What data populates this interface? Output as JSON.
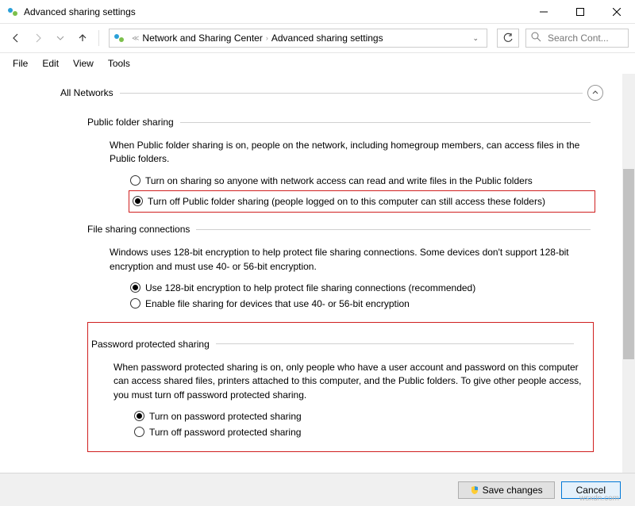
{
  "window": {
    "title": "Advanced sharing settings"
  },
  "nav": {
    "breadcrumb": {
      "parent": "Network and Sharing Center",
      "current": "Advanced sharing settings"
    },
    "search_placeholder": "Search Cont..."
  },
  "menu": {
    "file": "File",
    "edit": "Edit",
    "view": "View",
    "tools": "Tools"
  },
  "section": {
    "all_networks": "All Networks"
  },
  "public_folder": {
    "title": "Public folder sharing",
    "desc": "When Public folder sharing is on, people on the network, including homegroup members, can access files in the Public folders.",
    "opt_on": "Turn on sharing so anyone with network access can read and write files in the Public folders",
    "opt_off": "Turn off Public folder sharing (people logged on to this computer can still access these folders)"
  },
  "file_sharing": {
    "title": "File sharing connections",
    "desc": "Windows uses 128-bit encryption to help protect file sharing connections. Some devices don't support 128-bit encryption and must use 40- or 56-bit encryption.",
    "opt_128": "Use 128-bit encryption to help protect file sharing connections (recommended)",
    "opt_4056": "Enable file sharing for devices that use 40- or 56-bit encryption"
  },
  "password": {
    "title": "Password protected sharing",
    "desc": "When password protected sharing is on, only people who have a user account and password on this computer can access shared files, printers attached to this computer, and the Public folders. To give other people access, you must turn off password protected sharing.",
    "opt_on": "Turn on password protected sharing",
    "opt_off": "Turn off password protected sharing"
  },
  "buttons": {
    "save": "Save changes",
    "cancel": "Cancel"
  },
  "watermark": "wsxdn.com"
}
